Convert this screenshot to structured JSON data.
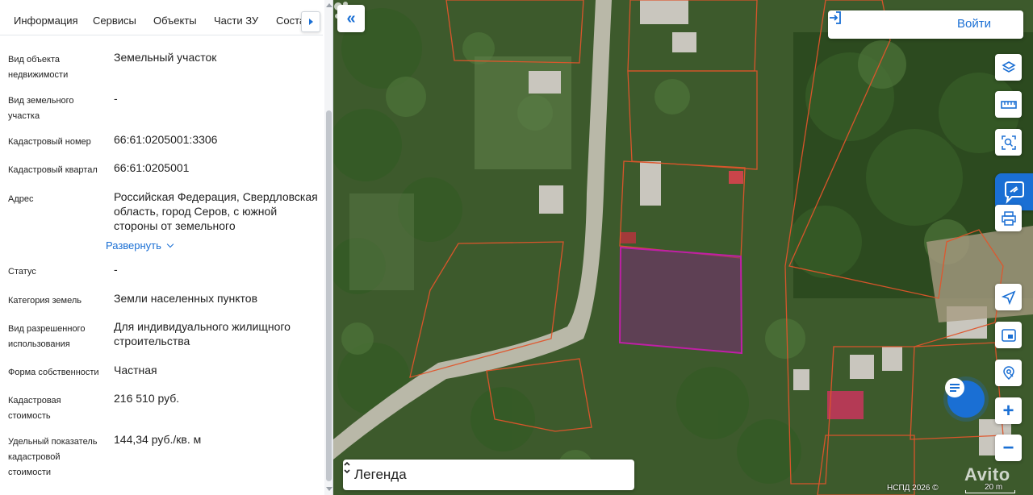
{
  "tabs": [
    {
      "label": "Информация",
      "active": true
    },
    {
      "label": "Сервисы",
      "active": false
    },
    {
      "label": "Объекты",
      "active": false
    },
    {
      "label": "Части ЗУ",
      "active": false
    },
    {
      "label": "Состав",
      "active": false
    }
  ],
  "fields": [
    {
      "label": "Вид объекта недвижимости",
      "value": "Земельный участок"
    },
    {
      "label": "Вид земельного участка",
      "value": "-"
    },
    {
      "label": "Кадастровый номер",
      "value": "66:61:0205001:3306"
    },
    {
      "label": "Кадастровый квартал",
      "value": "66:61:0205001"
    },
    {
      "label": "Адрес",
      "value": "Российская Федерация, Свердловская область, город Серов, с южной стороны от земельного"
    },
    {
      "label": "Статус",
      "value": "-"
    },
    {
      "label": "Категория земель",
      "value": "Земли населенных пунктов"
    },
    {
      "label": "Вид разрешенного использования",
      "value": "Для индивидуального жилищного строительства"
    },
    {
      "label": "Форма собственности",
      "value": "Частная"
    },
    {
      "label": "Кадастровая стоимость",
      "value": "216 510 руб."
    },
    {
      "label": "Удельный показатель кадастровой стоимости",
      "value": "144,34 руб./кв. м"
    }
  ],
  "expand_label": "Развернуть",
  "map": {
    "login_label": "Войти",
    "legend_label": "Легенда",
    "attribution": "НСПД 2026 ©",
    "scale_label": "20 m",
    "watermark": "Avito",
    "tools": [
      "layers-icon",
      "ruler-icon",
      "search-area-icon",
      "chat-widget-icon",
      "print-icon",
      "locate-icon",
      "map-view-icon",
      "geo-search-icon",
      "zoom-in-icon",
      "zoom-out-icon"
    ],
    "colors": {
      "accent": "#1a6fd4",
      "parcel_border": "#e0552b",
      "selected_parcel": "#b0209a"
    }
  }
}
